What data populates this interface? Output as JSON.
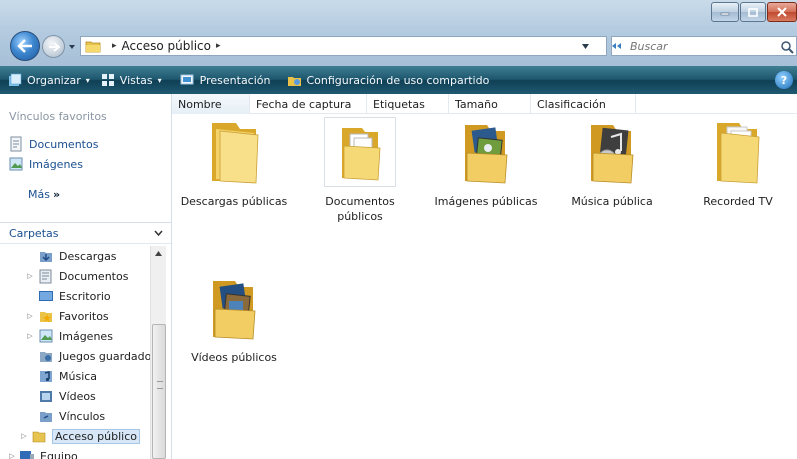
{
  "window": {
    "colors": {
      "accent": "#1d566d",
      "link": "#1a4f8f",
      "title": "#b4cbe0"
    }
  },
  "address": {
    "crumbs": [
      "Acceso público"
    ],
    "search_placeholder": "Buscar"
  },
  "toolbar": {
    "organize": "Organizar",
    "views": "Vistas",
    "slideshow": "Presentación",
    "sharing": "Configuración de uso compartido",
    "help": "?"
  },
  "favorites": {
    "header": "Vínculos favoritos",
    "items": [
      {
        "label": "Documentos",
        "icon": "documents-icon"
      },
      {
        "label": "Imágenes",
        "icon": "pictures-icon"
      }
    ],
    "more": "Más"
  },
  "folders": {
    "header": "Carpetas",
    "tree": [
      {
        "label": "Descargas",
        "icon": "downloads-icon",
        "expander": false
      },
      {
        "label": "Documentos",
        "icon": "documents-icon",
        "expander": true
      },
      {
        "label": "Escritorio",
        "icon": "desktop-icon",
        "expander": false
      },
      {
        "label": "Favoritos",
        "icon": "favorites-icon",
        "expander": true
      },
      {
        "label": "Imágenes",
        "icon": "pictures-icon",
        "expander": true
      },
      {
        "label": "Juegos guardado",
        "icon": "saved-games-icon",
        "expander": false
      },
      {
        "label": "Música",
        "icon": "music-icon",
        "expander": false
      },
      {
        "label": "Vídeos",
        "icon": "videos-icon",
        "expander": false
      },
      {
        "label": "Vínculos",
        "icon": "links-icon",
        "expander": false
      },
      {
        "label": "Acceso público",
        "icon": "folder-icon",
        "expander": true,
        "selected": true
      },
      {
        "label": "Equipo",
        "icon": "computer-icon",
        "expander": true
      }
    ]
  },
  "columns": [
    "Nombre",
    "Fecha de captura",
    "Etiquetas",
    "Tamaño",
    "Clasificación"
  ],
  "items": [
    {
      "label": "Descargas públicas",
      "type": "folder"
    },
    {
      "label": "Documentos públicos",
      "type": "documents-folder"
    },
    {
      "label": "Imágenes públicas",
      "type": "pictures-folder"
    },
    {
      "label": "Música pública",
      "type": "music-folder"
    },
    {
      "label": "Recorded TV",
      "type": "tv-folder"
    },
    {
      "label": "Vídeos públicos",
      "type": "videos-folder"
    }
  ]
}
